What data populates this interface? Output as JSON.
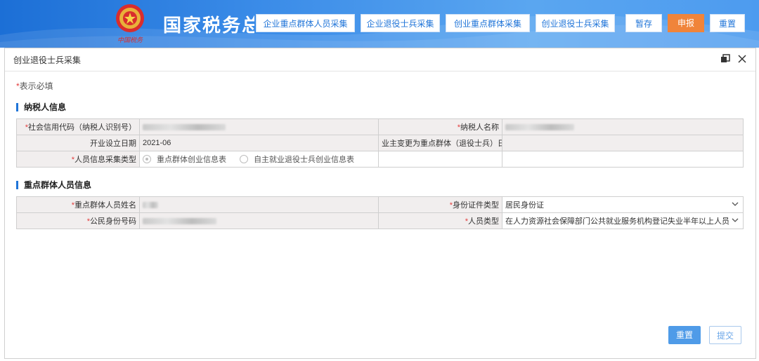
{
  "header": {
    "site_title": "国家税务总局",
    "emblem_text": "中国税务",
    "tabs": [
      "企业重点群体人员采集",
      "企业退役士兵采集",
      "创业重点群体采集",
      "创业退役士兵采集"
    ],
    "pause_label": "暂存",
    "submit_label": "申报",
    "reset_label": "重置",
    "accent_color": "#1f74d8",
    "submit_color": "#f0843a"
  },
  "dialog": {
    "title": "创业退役士兵采集",
    "restore_icon": "restore-window-icon",
    "close_icon": "close-icon",
    "required_star": "*",
    "required_note": "表示必填",
    "taxpayer_section": {
      "title": "纳税人信息",
      "credit_code_label": "社会信用代码（纳税人识别号）",
      "taxpayer_name_label": "纳税人名称",
      "open_date_label": "开业设立日期",
      "open_date_value": "2021-06",
      "owner_change_label": "业主变更为重点群体（退役士兵）日期",
      "collect_type_label": "人员信息采集类型",
      "radio_options": [
        "重点群体创业信息表",
        "自主就业退役士兵创业信息表"
      ]
    },
    "person_section": {
      "title": "重点群体人员信息",
      "name_label": "重点群体人员姓名",
      "id_type_label": "身份证件类型",
      "id_type_value": "居民身份证",
      "id_number_label": "公民身份号码",
      "person_type_label": "人员类型",
      "person_type_value": "在人力资源社会保障部门公共就业服务机构登记失业半年以上人员"
    },
    "footer": {
      "reset_label": "重置",
      "submit_label": "提交"
    }
  }
}
